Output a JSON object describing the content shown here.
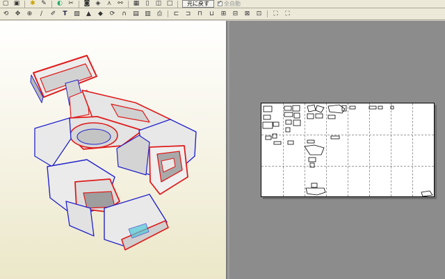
{
  "toolbar_top": {
    "restore_button_label": "元に戻す",
    "check_label": "全自動",
    "icons": [
      "file-icon",
      "open-icon",
      "save-icon",
      "print-icon",
      "edit-icon",
      "color-icon",
      "cut-icon",
      "copy-icon",
      "paste-icon",
      "undo-icon",
      "redo-icon",
      "grid-icon",
      "view1-icon",
      "view2-icon",
      "view3-icon"
    ]
  },
  "toolbar_bottom": {
    "icons": [
      "rotate-icon",
      "move-icon",
      "zoom-icon",
      "line-icon",
      "text-icon",
      "image-icon",
      "cube-icon",
      "unfold-icon",
      "join-icon",
      "page-icon",
      "arrange-icon",
      "align-left-icon",
      "align-right-icon",
      "flip-icon",
      "fit-icon",
      "fit-all-icon"
    ]
  },
  "colors": {
    "accent_red": "#e01a1a",
    "accent_blue": "#2222cc",
    "panel_gray": "#8c8c8c",
    "paper_white": "#ffffff"
  }
}
